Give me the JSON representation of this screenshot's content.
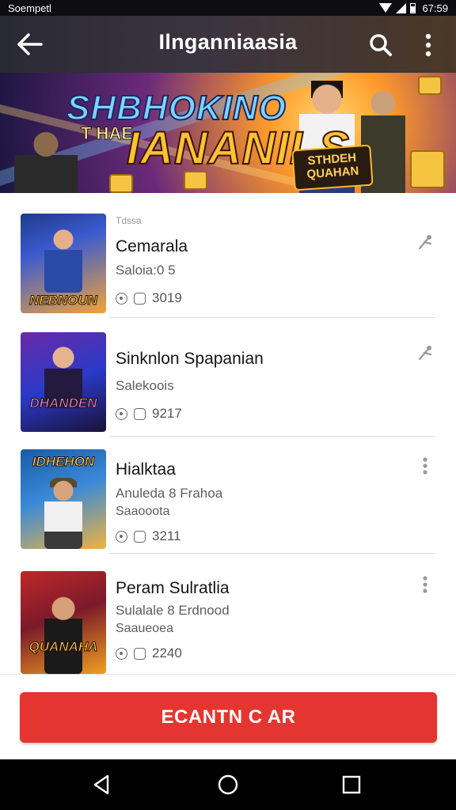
{
  "status_bar": {
    "carrier": "Soempetl",
    "time": "67:59",
    "icons": [
      "wifi-icon",
      "signal-icon",
      "battery-icon"
    ]
  },
  "app_bar": {
    "title": "Ilnganniaasia",
    "icons": [
      "back-arrow-icon",
      "search-icon",
      "more-vert-icon"
    ]
  },
  "banner": {
    "line1": "SHBHOKINO",
    "line2": "T HAE",
    "line3": "IANANILS",
    "badge": "STHDEH QUAHAN"
  },
  "list": {
    "items": [
      {
        "kicker": "Tdssa",
        "title": "Cemarala",
        "subtitle": "Saloia:0 5",
        "meta_value": "3019",
        "thumb_text": "NEBNOUN",
        "action_icon": "share-icon",
        "colors": {
          "from": "#1e3a8a",
          "to": "#f2a33a"
        }
      },
      {
        "kicker": "",
        "title": "Sinknlon Spapanian",
        "subtitle": "Salekoois",
        "meta_value": "9217",
        "thumb_text": "DHANDEN",
        "action_icon": "share-icon",
        "colors": {
          "from": "#6a2aa8",
          "to": "#1a1238"
        }
      },
      {
        "kicker": "",
        "title": "Hialktaa",
        "subtitle": "Anuleda 8 Frahoa",
        "subtitle2": "Saaooota",
        "meta_value": "3211",
        "thumb_text": "IDHEHON",
        "action_icon": "more-vert-icon",
        "colors": {
          "from": "#1a5aa8",
          "to": "#f0b340"
        }
      },
      {
        "kicker": "",
        "title": "Peram Sulratlia",
        "subtitle": "Sulalale 8 Erdnood",
        "subtitle2": "Saaueoea",
        "meta_value": "2240",
        "thumb_text": "QUANAHA",
        "action_icon": "more-vert-icon",
        "colors": {
          "from": "#c0282a",
          "to": "#f0a020"
        }
      }
    ]
  },
  "cta": {
    "label": "ECANTN C AR",
    "color": "#e53530"
  },
  "nav_bar": {
    "icons": [
      "back-triangle-icon",
      "home-circle-icon",
      "recents-square-icon"
    ]
  }
}
